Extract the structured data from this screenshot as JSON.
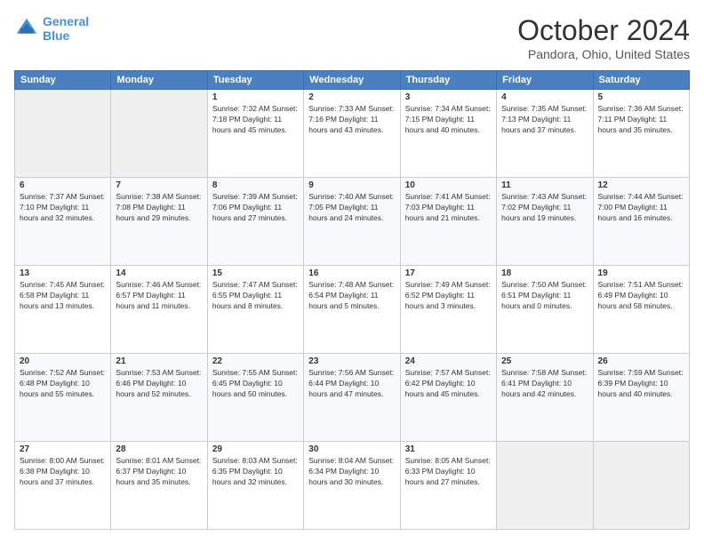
{
  "header": {
    "logo_line1": "General",
    "logo_line2": "Blue",
    "month": "October 2024",
    "location": "Pandora, Ohio, United States"
  },
  "days_of_week": [
    "Sunday",
    "Monday",
    "Tuesday",
    "Wednesday",
    "Thursday",
    "Friday",
    "Saturday"
  ],
  "weeks": [
    [
      {
        "num": "",
        "info": ""
      },
      {
        "num": "",
        "info": ""
      },
      {
        "num": "1",
        "info": "Sunrise: 7:32 AM\nSunset: 7:18 PM\nDaylight: 11 hours and 45 minutes."
      },
      {
        "num": "2",
        "info": "Sunrise: 7:33 AM\nSunset: 7:16 PM\nDaylight: 11 hours and 43 minutes."
      },
      {
        "num": "3",
        "info": "Sunrise: 7:34 AM\nSunset: 7:15 PM\nDaylight: 11 hours and 40 minutes."
      },
      {
        "num": "4",
        "info": "Sunrise: 7:35 AM\nSunset: 7:13 PM\nDaylight: 11 hours and 37 minutes."
      },
      {
        "num": "5",
        "info": "Sunrise: 7:36 AM\nSunset: 7:11 PM\nDaylight: 11 hours and 35 minutes."
      }
    ],
    [
      {
        "num": "6",
        "info": "Sunrise: 7:37 AM\nSunset: 7:10 PM\nDaylight: 11 hours and 32 minutes."
      },
      {
        "num": "7",
        "info": "Sunrise: 7:38 AM\nSunset: 7:08 PM\nDaylight: 11 hours and 29 minutes."
      },
      {
        "num": "8",
        "info": "Sunrise: 7:39 AM\nSunset: 7:06 PM\nDaylight: 11 hours and 27 minutes."
      },
      {
        "num": "9",
        "info": "Sunrise: 7:40 AM\nSunset: 7:05 PM\nDaylight: 11 hours and 24 minutes."
      },
      {
        "num": "10",
        "info": "Sunrise: 7:41 AM\nSunset: 7:03 PM\nDaylight: 11 hours and 21 minutes."
      },
      {
        "num": "11",
        "info": "Sunrise: 7:43 AM\nSunset: 7:02 PM\nDaylight: 11 hours and 19 minutes."
      },
      {
        "num": "12",
        "info": "Sunrise: 7:44 AM\nSunset: 7:00 PM\nDaylight: 11 hours and 16 minutes."
      }
    ],
    [
      {
        "num": "13",
        "info": "Sunrise: 7:45 AM\nSunset: 6:58 PM\nDaylight: 11 hours and 13 minutes."
      },
      {
        "num": "14",
        "info": "Sunrise: 7:46 AM\nSunset: 6:57 PM\nDaylight: 11 hours and 11 minutes."
      },
      {
        "num": "15",
        "info": "Sunrise: 7:47 AM\nSunset: 6:55 PM\nDaylight: 11 hours and 8 minutes."
      },
      {
        "num": "16",
        "info": "Sunrise: 7:48 AM\nSunset: 6:54 PM\nDaylight: 11 hours and 5 minutes."
      },
      {
        "num": "17",
        "info": "Sunrise: 7:49 AM\nSunset: 6:52 PM\nDaylight: 11 hours and 3 minutes."
      },
      {
        "num": "18",
        "info": "Sunrise: 7:50 AM\nSunset: 6:51 PM\nDaylight: 11 hours and 0 minutes."
      },
      {
        "num": "19",
        "info": "Sunrise: 7:51 AM\nSunset: 6:49 PM\nDaylight: 10 hours and 58 minutes."
      }
    ],
    [
      {
        "num": "20",
        "info": "Sunrise: 7:52 AM\nSunset: 6:48 PM\nDaylight: 10 hours and 55 minutes."
      },
      {
        "num": "21",
        "info": "Sunrise: 7:53 AM\nSunset: 6:46 PM\nDaylight: 10 hours and 52 minutes."
      },
      {
        "num": "22",
        "info": "Sunrise: 7:55 AM\nSunset: 6:45 PM\nDaylight: 10 hours and 50 minutes."
      },
      {
        "num": "23",
        "info": "Sunrise: 7:56 AM\nSunset: 6:44 PM\nDaylight: 10 hours and 47 minutes."
      },
      {
        "num": "24",
        "info": "Sunrise: 7:57 AM\nSunset: 6:42 PM\nDaylight: 10 hours and 45 minutes."
      },
      {
        "num": "25",
        "info": "Sunrise: 7:58 AM\nSunset: 6:41 PM\nDaylight: 10 hours and 42 minutes."
      },
      {
        "num": "26",
        "info": "Sunrise: 7:59 AM\nSunset: 6:39 PM\nDaylight: 10 hours and 40 minutes."
      }
    ],
    [
      {
        "num": "27",
        "info": "Sunrise: 8:00 AM\nSunset: 6:38 PM\nDaylight: 10 hours and 37 minutes."
      },
      {
        "num": "28",
        "info": "Sunrise: 8:01 AM\nSunset: 6:37 PM\nDaylight: 10 hours and 35 minutes."
      },
      {
        "num": "29",
        "info": "Sunrise: 8:03 AM\nSunset: 6:35 PM\nDaylight: 10 hours and 32 minutes."
      },
      {
        "num": "30",
        "info": "Sunrise: 8:04 AM\nSunset: 6:34 PM\nDaylight: 10 hours and 30 minutes."
      },
      {
        "num": "31",
        "info": "Sunrise: 8:05 AM\nSunset: 6:33 PM\nDaylight: 10 hours and 27 minutes."
      },
      {
        "num": "",
        "info": ""
      },
      {
        "num": "",
        "info": ""
      }
    ]
  ]
}
